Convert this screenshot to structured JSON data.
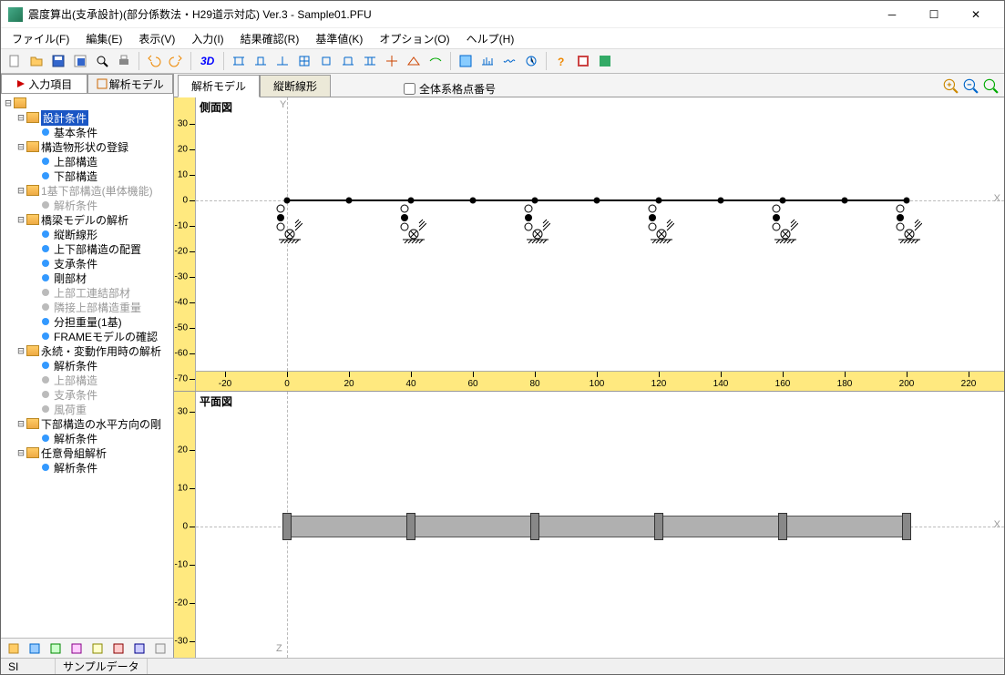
{
  "window": {
    "title": "震度算出(支承設計)(部分係数法・H29道示対応) Ver.3 - Sample01.PFU"
  },
  "menu": [
    "ファイル(F)",
    "編集(E)",
    "表示(V)",
    "入力(I)",
    "結果確認(R)",
    "基準値(K)",
    "オプション(O)",
    "ヘルプ(H)"
  ],
  "toolbar": {
    "btn3d": "3D"
  },
  "sidebar": {
    "tabs": {
      "input": "入力項目",
      "model": "解析モデル"
    },
    "tree": [
      {
        "d": 0,
        "t": "f",
        "e": "-",
        "l": ""
      },
      {
        "d": 1,
        "t": "f",
        "e": "-",
        "l": "設計条件",
        "sel": true
      },
      {
        "d": 2,
        "t": "b",
        "c": "blue",
        "l": "基本条件"
      },
      {
        "d": 1,
        "t": "f",
        "e": "-",
        "l": "構造物形状の登録"
      },
      {
        "d": 2,
        "t": "b",
        "c": "blue",
        "l": "上部構造"
      },
      {
        "d": 2,
        "t": "b",
        "c": "blue",
        "l": "下部構造"
      },
      {
        "d": 1,
        "t": "f",
        "e": "-",
        "l": "1基下部構造(単体機能)",
        "dis": true
      },
      {
        "d": 2,
        "t": "b",
        "c": "grey",
        "l": "解析条件",
        "dis": true
      },
      {
        "d": 1,
        "t": "f",
        "e": "-",
        "l": "橋梁モデルの解析"
      },
      {
        "d": 2,
        "t": "b",
        "c": "blue",
        "l": "縦断線形"
      },
      {
        "d": 2,
        "t": "b",
        "c": "blue",
        "l": "上下部構造の配置"
      },
      {
        "d": 2,
        "t": "b",
        "c": "blue",
        "l": "支承条件"
      },
      {
        "d": 2,
        "t": "b",
        "c": "blue",
        "l": "剛部材"
      },
      {
        "d": 2,
        "t": "b",
        "c": "grey",
        "l": "上部工連結部材",
        "dis": true
      },
      {
        "d": 2,
        "t": "b",
        "c": "grey",
        "l": "隣接上部構造重量",
        "dis": true
      },
      {
        "d": 2,
        "t": "b",
        "c": "blue",
        "l": "分担重量(1基)"
      },
      {
        "d": 2,
        "t": "b",
        "c": "blue",
        "l": "FRAMEモデルの確認"
      },
      {
        "d": 1,
        "t": "f",
        "e": "-",
        "l": "永続・変動作用時の解析"
      },
      {
        "d": 2,
        "t": "b",
        "c": "blue",
        "l": "解析条件"
      },
      {
        "d": 2,
        "t": "b",
        "c": "grey",
        "l": "上部構造",
        "dis": true
      },
      {
        "d": 2,
        "t": "b",
        "c": "grey",
        "l": "支承条件",
        "dis": true
      },
      {
        "d": 2,
        "t": "b",
        "c": "grey",
        "l": "風荷重",
        "dis": true
      },
      {
        "d": 1,
        "t": "f",
        "e": "-",
        "l": "下部構造の水平方向の剛"
      },
      {
        "d": 2,
        "t": "b",
        "c": "blue",
        "l": "解析条件"
      },
      {
        "d": 1,
        "t": "f",
        "e": "-",
        "l": "任意骨組解析"
      },
      {
        "d": 2,
        "t": "b",
        "c": "blue",
        "l": "解析条件"
      }
    ]
  },
  "content": {
    "tabs": {
      "model": "解析モデル",
      "profile": "縦断線形"
    },
    "checkbox": "全体系格点番号",
    "views": {
      "side": "側面図",
      "plan": "平面図"
    },
    "vruler_side": [
      30,
      20,
      10,
      0,
      -10,
      -20,
      -30,
      -40,
      -50,
      -60,
      -70
    ],
    "vruler_plan": [
      30,
      20,
      10,
      0,
      -10,
      -20,
      -30
    ],
    "hruler": [
      -20,
      0,
      20,
      40,
      60,
      80,
      100,
      120,
      140,
      160,
      180,
      200,
      220
    ],
    "axis": {
      "x": "X",
      "y": "Y",
      "z": "Z"
    },
    "piers_x": [
      0,
      40,
      80,
      120,
      160,
      200
    ],
    "nodes_x": [
      0,
      20,
      40,
      60,
      80,
      100,
      120,
      140,
      160,
      180,
      200
    ]
  },
  "status": {
    "left": "SI",
    "file": "サンプルデータ"
  }
}
